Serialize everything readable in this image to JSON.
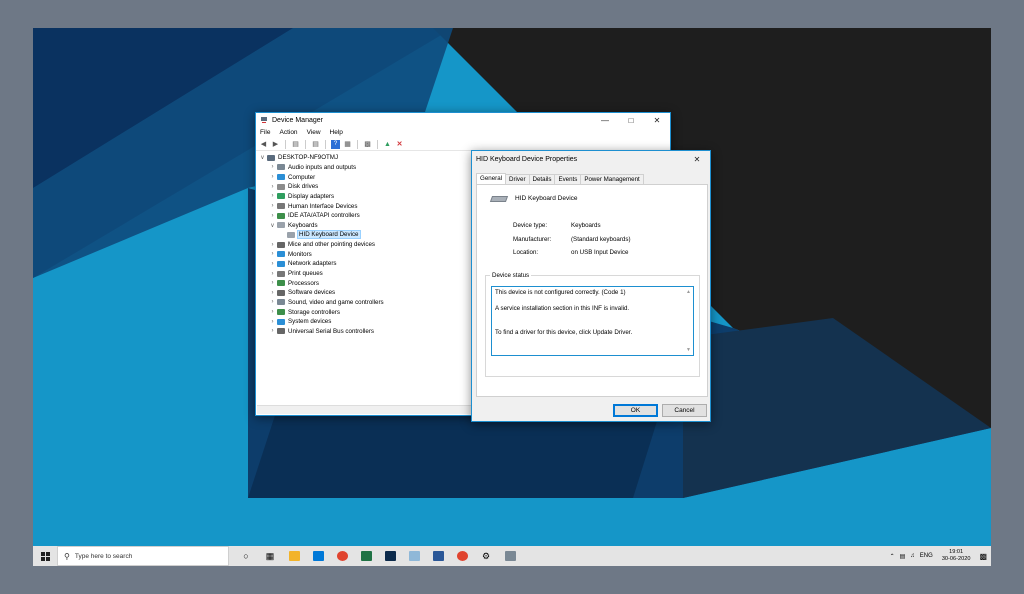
{
  "colors": {
    "accent": "#0078d7",
    "wallpaper_light": "#1596c8",
    "wallpaper_dark": "#0d3d6b",
    "dark_panel": "#1e1e1e"
  },
  "device_manager": {
    "title": "Device Manager",
    "menu": [
      "File",
      "Action",
      "View",
      "Help"
    ],
    "tree": [
      {
        "label": "DESKTOP-NF9OTMJ",
        "level": 0,
        "expanded": true,
        "icon": "computer-icon",
        "color": "#5a6b7d"
      },
      {
        "label": "Audio inputs and outputs",
        "level": 1,
        "expanded": false,
        "icon": "speaker-icon",
        "color": "#7a8894"
      },
      {
        "label": "Computer",
        "level": 1,
        "expanded": false,
        "icon": "monitor-icon",
        "color": "#2b8fd6"
      },
      {
        "label": "Disk drives",
        "level": 1,
        "expanded": false,
        "icon": "disk-icon",
        "color": "#8c8c8c"
      },
      {
        "label": "Display adapters",
        "level": 1,
        "expanded": false,
        "icon": "display-adapter-icon",
        "color": "#2f9e5f"
      },
      {
        "label": "Human Interface Devices",
        "level": 1,
        "expanded": false,
        "icon": "hid-icon",
        "color": "#777"
      },
      {
        "label": "IDE ATA/ATAPI controllers",
        "level": 1,
        "expanded": false,
        "icon": "controller-icon",
        "color": "#3d8f4a"
      },
      {
        "label": "Keyboards",
        "level": 1,
        "expanded": true,
        "icon": "keyboard-icon",
        "color": "#9aa2ab"
      },
      {
        "label": "HID Keyboard Device",
        "level": 2,
        "expanded": null,
        "icon": "keyboard-icon",
        "color": "#9aa2ab",
        "selected": true
      },
      {
        "label": "Mice and other pointing devices",
        "level": 1,
        "expanded": false,
        "icon": "mouse-icon",
        "color": "#666"
      },
      {
        "label": "Monitors",
        "level": 1,
        "expanded": false,
        "icon": "monitor-icon",
        "color": "#2b8fd6"
      },
      {
        "label": "Network adapters",
        "level": 1,
        "expanded": false,
        "icon": "network-icon",
        "color": "#2b8fd6"
      },
      {
        "label": "Print queues",
        "level": 1,
        "expanded": false,
        "icon": "printer-icon",
        "color": "#777"
      },
      {
        "label": "Processors",
        "level": 1,
        "expanded": false,
        "icon": "processor-icon",
        "color": "#3d8f4a"
      },
      {
        "label": "Software devices",
        "level": 1,
        "expanded": false,
        "icon": "software-device-icon",
        "color": "#666"
      },
      {
        "label": "Sound, video and game controllers",
        "level": 1,
        "expanded": false,
        "icon": "sound-icon",
        "color": "#7a8894"
      },
      {
        "label": "Storage controllers",
        "level": 1,
        "expanded": false,
        "icon": "storage-icon",
        "color": "#3d8f4a"
      },
      {
        "label": "System devices",
        "level": 1,
        "expanded": false,
        "icon": "system-icon",
        "color": "#2b8fd6"
      },
      {
        "label": "Universal Serial Bus controllers",
        "level": 1,
        "expanded": false,
        "icon": "usb-icon",
        "color": "#666"
      }
    ]
  },
  "properties": {
    "title": "HID Keyboard Device Properties",
    "tabs": [
      "General",
      "Driver",
      "Details",
      "Events",
      "Power Management"
    ],
    "device_name": "HID Keyboard Device",
    "device_type_label": "Device type:",
    "device_type": "Keyboards",
    "manufacturer_label": "Manufacturer:",
    "manufacturer": "(Standard keyboards)",
    "location_label": "Location:",
    "location": "on USB Input Device",
    "status_legend": "Device status",
    "status_lines": [
      "This device is not configured correctly. (Code 1)",
      "",
      "A service installation section in this INF is invalid.",
      "",
      "",
      "To find a driver for this device, click Update Driver."
    ],
    "ok_label": "OK",
    "cancel_label": "Cancel"
  },
  "taskbar": {
    "search_placeholder": "Type here to search",
    "language": "ENG",
    "time": "19:01",
    "date": "30-06-2020"
  }
}
